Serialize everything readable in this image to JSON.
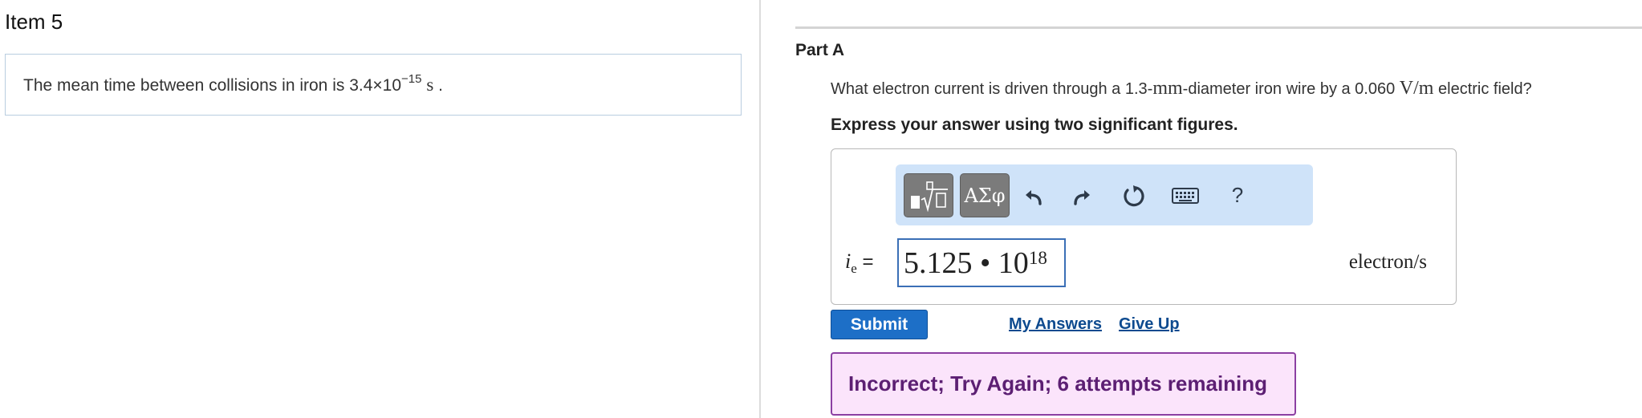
{
  "item": {
    "title": "Item 5",
    "intro_text": "The mean time between collisions in iron is 3.4×10",
    "intro_exponent": "−15",
    "intro_unit": "s",
    "intro_end": "."
  },
  "part": {
    "title": "Part A",
    "question_pre": "What electron current is driven through a 1.3-",
    "question_mm": "mm",
    "question_mid": "-diameter iron wire by a 0.060 ",
    "question_unit": "V/m",
    "question_post": " electric field?",
    "instruction": "Express your answer using two significant figures."
  },
  "toolbar": {
    "template_icon": "fraction-sqrt-template-icon",
    "greek_label": "ΑΣφ",
    "undo_icon": "undo-icon",
    "redo_icon": "redo-icon",
    "reset_icon": "reset-icon",
    "keyboard_icon": "keyboard-icon",
    "help_label": "?"
  },
  "answer": {
    "var_symbol": "i",
    "var_sub": "e",
    "equals": " = ",
    "mantissa": "5.125 • 10",
    "exponent": "18",
    "unit": "electron/s"
  },
  "actions": {
    "submit_label": "Submit",
    "my_answers_label": "My Answers",
    "give_up_label": "Give Up"
  },
  "feedback": {
    "text": "Incorrect; Try Again; 6 attempts remaining"
  },
  "colors": {
    "submit_bg": "#1d6fc7",
    "toolbar_bg": "#cfe3f9",
    "feedback_bg": "#fbe4fb",
    "feedback_border": "#8b3fa2",
    "link": "#0d4a8f"
  }
}
